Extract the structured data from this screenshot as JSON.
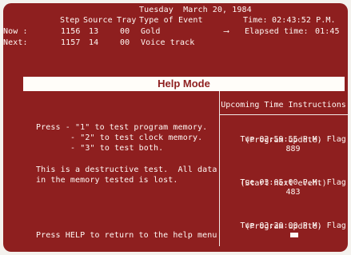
{
  "header": {
    "date": "Tuesday  March 20, 1984"
  },
  "columns": {
    "step": "Step",
    "source": "Source",
    "tray": "Tray",
    "type": "Type of Event"
  },
  "time": {
    "time_label": "Time:",
    "time_value": "02:43:52 P.M.",
    "elapsed_label": "Elapsed time:",
    "elapsed_value": "01:45"
  },
  "events": {
    "now_label": "Now :",
    "now_step": "1156",
    "now_source": "13",
    "now_tray": "00",
    "now_type": "Gold",
    "next_label": "Next:",
    "next_step": "1157",
    "next_source": "14",
    "next_tray": "00",
    "next_type": "Voice track"
  },
  "mode": {
    "title": "Help Mode"
  },
  "help": {
    "line1": "Press - \"1\" to test program memory.",
    "line2": "- \"2\" to test clock memory.",
    "line3": "- \"3\" to test both.",
    "line4": "This is a destructive test.  All data",
    "line5": "in the memory tested is lost.",
    "footer": "Press HELP to return to the help menu"
  },
  "upcoming": {
    "title": "Upcoming Time Instructions",
    "items": [
      {
        "line1": "Tue 02:59:55 P.M. Flag",
        "flag": "889",
        "line2": "(Program update)"
      },
      {
        "line1": "Tue 03:05:00 P.M. Flag",
        "flag": "483",
        "line2": "(Start next event)"
      },
      {
        "line1": "Tue 03:20:00 P.M. Flag",
        "flag": "",
        "line2": "(Program update)"
      }
    ]
  },
  "colors": {
    "screen": "#8e1f1f",
    "text": "#fff8f4"
  }
}
